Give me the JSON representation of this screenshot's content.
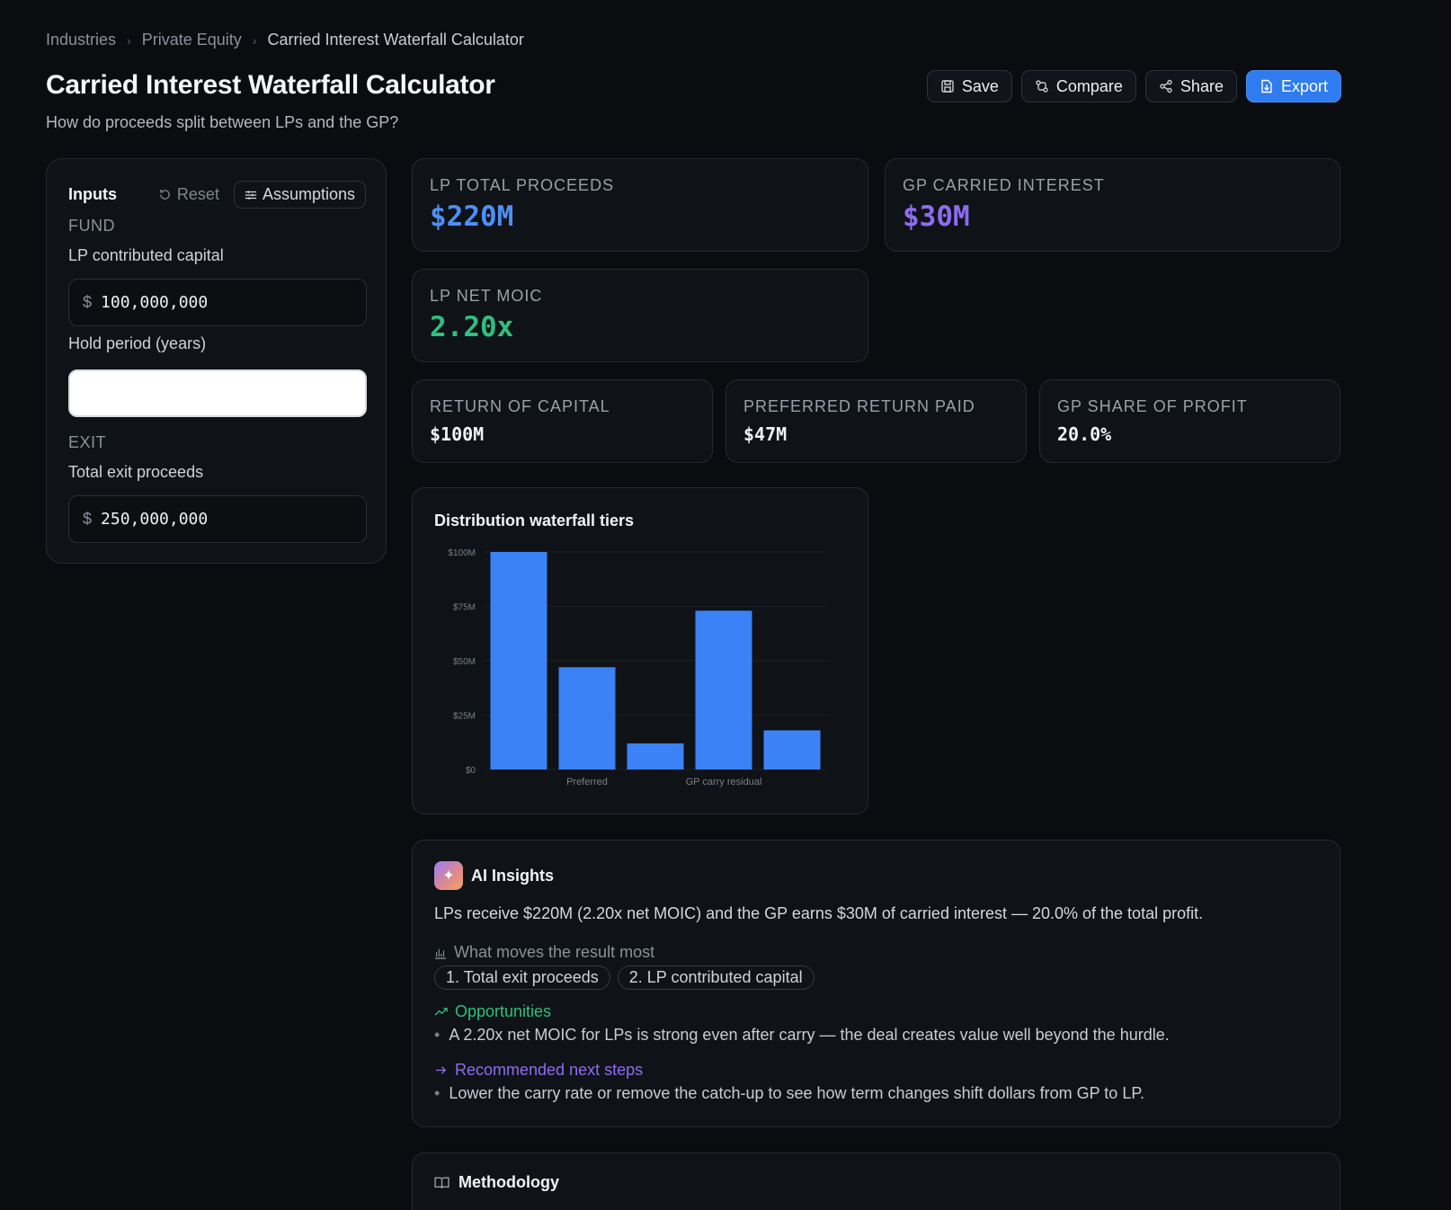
{
  "breadcrumb": {
    "items": [
      "Industries",
      "Private Equity",
      "Carried Interest Waterfall Calculator"
    ]
  },
  "header": {
    "title": "Carried Interest Waterfall Calculator",
    "subtitle": "How do proceeds split between LPs and the GP?",
    "buttons": {
      "save": "Save",
      "compare": "Compare",
      "share": "Share",
      "export": "Export"
    }
  },
  "inputs": {
    "title": "Inputs",
    "reset": "Reset",
    "assumptions": "Assumptions",
    "fund_section": "FUND",
    "lp_capital_label": "LP contributed capital",
    "currency": "$",
    "lp_capital_value": "100,000,000",
    "hold_label": "Hold period (years)",
    "hold_value": "",
    "exit_section": "EXIT",
    "exit_label": "Total exit proceeds",
    "exit_value": "250,000,000"
  },
  "metrics": {
    "lp_total": {
      "label": "LP TOTAL PROCEEDS",
      "value": "$220M",
      "color": "#4d8ff7"
    },
    "gp_carry": {
      "label": "GP CARRIED INTEREST",
      "value": "$30M",
      "color": "#8f6cf2"
    },
    "lp_moic": {
      "label": "LP NET MOIC",
      "value": "2.20x",
      "color": "#2fbf7f"
    },
    "roc": {
      "label": "RETURN OF CAPITAL",
      "value": "$100M"
    },
    "pref": {
      "label": "PREFERRED RETURN PAID",
      "value": "$47M"
    },
    "gp_share": {
      "label": "GP SHARE OF PROFIT",
      "value": "20.0%"
    }
  },
  "chart": {
    "title": "Distribution waterfall tiers"
  },
  "chart_data": {
    "type": "bar",
    "title": "Distribution waterfall tiers",
    "categories": [
      "",
      "Preferred",
      "",
      "GP carry residual",
      ""
    ],
    "values": [
      100,
      47,
      12,
      73,
      18
    ],
    "y_ticks": [
      {
        "v": 0,
        "label": "$0"
      },
      {
        "v": 25,
        "label": "$25M"
      },
      {
        "v": 50,
        "label": "$50M"
      },
      {
        "v": 75,
        "label": "$75M"
      },
      {
        "v": 100,
        "label": "$100M"
      }
    ],
    "ylim": [
      0,
      100
    ],
    "bar_color": "#3b82f6",
    "grid": true
  },
  "insights": {
    "title": "AI Insights",
    "summary": "LPs receive $220M (2.20x net MOIC) and the GP earns $30M of carried interest — 20.0% of the total profit.",
    "drivers_title": "What moves the result most",
    "drivers": [
      "1. Total exit proceeds",
      "2. LP contributed capital"
    ],
    "opportunities_title": "Opportunities",
    "opportunities_color": "#2fbf7f",
    "opportunities": [
      "A 2.20x net MOIC for LPs is strong even after carry — the deal creates value well beyond the hurdle."
    ],
    "next_title": "Recommended next steps",
    "next_color": "#8f6cf2",
    "next": [
      "Lower the carry rate or remove the catch-up to see how term changes shift dollars from GP to LP."
    ]
  },
  "methodology": {
    "title": "Methodology"
  }
}
